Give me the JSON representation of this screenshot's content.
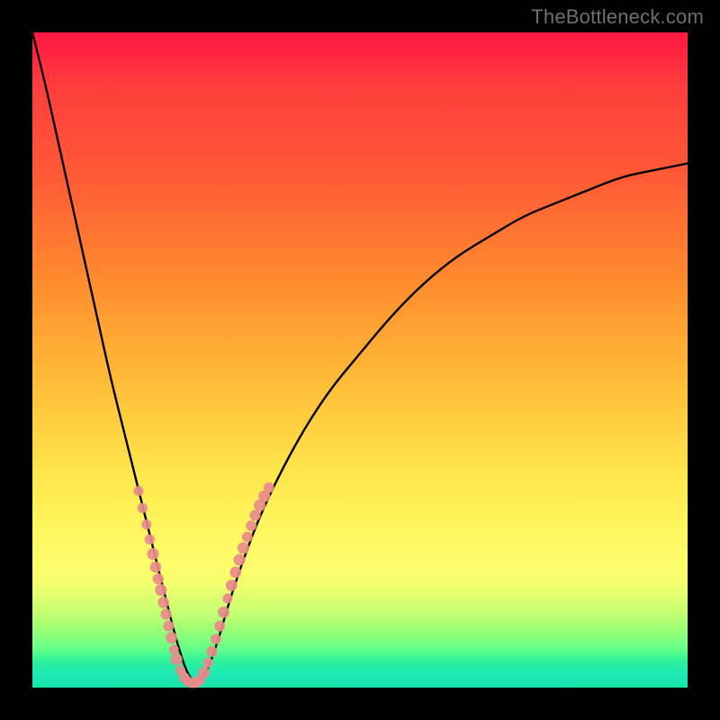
{
  "watermark": {
    "text": "TheBottleneck.com"
  },
  "chart_data": {
    "type": "line",
    "title": "",
    "xlabel": "",
    "ylabel": "",
    "xlim": [
      0,
      100
    ],
    "ylim": [
      0,
      100
    ],
    "legend": false,
    "grid": false,
    "series": [
      {
        "name": "bottleneck-curve",
        "comment": "V-shaped bottleneck curve; y ≈ 100 at x=0, bottoms near y≈0 around x≈24, rises back toward y≈80 at x=100. Values estimated from plot proportions.",
        "x": [
          0,
          2,
          4,
          6,
          8,
          10,
          12,
          14,
          16,
          18,
          20,
          22,
          24,
          26,
          28,
          30,
          32,
          35,
          40,
          45,
          50,
          55,
          60,
          65,
          70,
          75,
          80,
          85,
          90,
          95,
          100
        ],
        "y": [
          100,
          92,
          83,
          74,
          65,
          56,
          47,
          39,
          31,
          23,
          15,
          7,
          1,
          1,
          6,
          13,
          19,
          27,
          37,
          45,
          51,
          57,
          62,
          66,
          69,
          72,
          74,
          76,
          78,
          79,
          80
        ]
      },
      {
        "name": "highlight-dots-left-arm",
        "comment": "Pink/salmon dot cluster along lower-left descending arm near bottom. Coordinates approximate.",
        "type": "scatter",
        "color": "#e98b8b",
        "x": [
          16.2,
          16.8,
          17.4,
          17.9,
          18.4,
          18.8,
          19.2,
          19.6,
          20.0,
          20.4,
          20.8,
          21.2,
          21.6,
          22.0,
          22.6,
          23.2,
          23.8,
          24.4,
          25.0
        ],
        "y": [
          30.0,
          27.4,
          24.9,
          22.6,
          20.4,
          18.4,
          16.6,
          14.9,
          13.0,
          11.2,
          9.4,
          7.6,
          5.8,
          4.3,
          2.6,
          1.5,
          0.9,
          0.7,
          0.8
        ]
      },
      {
        "name": "highlight-dots-right-arm",
        "comment": "Pink/salmon dot cluster along lower-right ascending arm near bottom. Coordinates approximate.",
        "type": "scatter",
        "color": "#e98b8b",
        "x": [
          25.6,
          26.2,
          26.8,
          27.4,
          28.0,
          28.6,
          29.2,
          29.8,
          30.4,
          31.0,
          31.6,
          32.2,
          32.8,
          33.4,
          34.0,
          34.7,
          35.4,
          36.1
        ],
        "y": [
          1.2,
          2.3,
          3.8,
          5.5,
          7.4,
          9.4,
          11.5,
          13.6,
          15.6,
          17.6,
          19.5,
          21.3,
          23.0,
          24.7,
          26.3,
          27.8,
          29.2,
          30.5
        ]
      }
    ]
  }
}
